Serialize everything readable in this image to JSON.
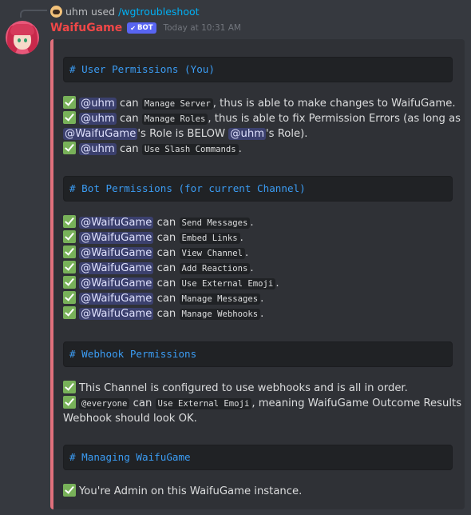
{
  "reply": {
    "user": "uhm",
    "used_text": "used",
    "command": "/wgtroubleshoot"
  },
  "message": {
    "username": "WaifuGame",
    "bot_tag": "BOT",
    "timestamp": "Today at 10:31 AM"
  },
  "embed": {
    "accent_color": "#e0707c",
    "headers": {
      "user_permissions": "# User Permissions (You)",
      "bot_permissions": "# Bot Permissions (for current Channel)",
      "webhook_permissions": "# Webhook Permissions",
      "managing": "# Managing WaifuGame"
    },
    "user_section": {
      "l1": {
        "mention": "@uhm",
        "can": "can",
        "perm": "Manage Server",
        "rest": ", thus is able to make changes to WaifuGame."
      },
      "l2": {
        "mention": "@uhm",
        "can": "can",
        "perm": "Manage Roles",
        "rest": ", thus is able to fix Permission Errors (as long as"
      },
      "l3": {
        "mention1": "@WaifuGame",
        "mid": "'s Role is BELOW",
        "mention2": "@uhm",
        "rest": "'s Role)."
      },
      "l4": {
        "mention": "@uhm",
        "can": "can",
        "perm": "Use Slash Commands",
        "rest": "."
      }
    },
    "bot_section": {
      "mention": "@WaifuGame",
      "can": "can",
      "end": ".",
      "perms": [
        "Send Messages",
        "Embed Links",
        "View Channel",
        "Add Reactions",
        "Use External Emoji",
        "Manage Messages",
        "Manage Webhooks"
      ]
    },
    "webhook_section": {
      "l1": "This Channel is configured to use webhooks and is all in order.",
      "l2": {
        "mention": "@everyone",
        "can": "can",
        "perm": "Use External Emoji",
        "rest": ", meaning WaifuGame Outcome Results via"
      },
      "l3": "Webhook should look OK."
    },
    "managing_section": {
      "l1": "You're Admin on this WaifuGame instance."
    }
  }
}
